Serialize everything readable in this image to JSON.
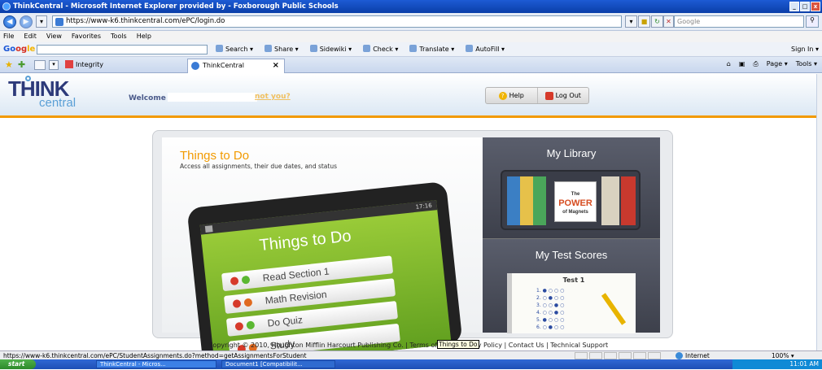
{
  "window": {
    "title": "ThinkCentral - Microsoft Internet Explorer provided by - Foxborough Public Schools",
    "controls": [
      "_",
      "□",
      "x"
    ]
  },
  "address": {
    "url": "https://www-k6.thinkcentral.com/ePC/login.do",
    "search_placeholder": "Google"
  },
  "menu": [
    "File",
    "Edit",
    "View",
    "Favorites",
    "Tools",
    "Help"
  ],
  "googlebar": {
    "logo": [
      "Go",
      "og",
      "le"
    ],
    "tools": [
      "Search ▾",
      "Share ▾",
      "Sidewiki ▾",
      "Check ▾",
      "Translate ▾",
      "AutoFill ▾"
    ],
    "signin": "Sign In ▾"
  },
  "tabs": {
    "bookmark": "Integrity",
    "active": "ThinkCentral",
    "commands": [
      "Page ▾",
      "Tools ▾"
    ]
  },
  "header": {
    "logo_think": "THINK",
    "logo_central": "central",
    "welcome": "Welcome",
    "notyou": "not you?",
    "help": "Help",
    "logout": "Log Out"
  },
  "todo": {
    "title": "Things to Do",
    "subtitle": "Access all assignments, their due dates, and status",
    "screen_title": "Things to Do",
    "time": "17:16",
    "tasks": [
      "Read Section 1",
      "Math Revision",
      "Do Quiz",
      "Study"
    ]
  },
  "library": {
    "title": "My Library",
    "book_title": "POWER",
    "book_top": "The",
    "book_bottom": "of Magnets"
  },
  "scores": {
    "title": "My Test Scores",
    "sheet_title": "Test 1",
    "rows": [
      "1.",
      "2.",
      "3.",
      "4.",
      "5.",
      "6."
    ]
  },
  "footer": {
    "copyright": "Copyright © 2010, Houghton Mifflin Harcourt Publishing Co. | Terms of Use | Privacy Policy | Contact Us | Technical Support",
    "tooltip": "Things to Do"
  },
  "status": {
    "url": "https://www-k6.thinkcentral.com/ePC/StudentAssignments.do?method=getAssignmentsForStudent",
    "zone": "Internet",
    "zoom": "100% ▾"
  },
  "taskbar": {
    "start": "start",
    "task1": "ThinkCentral - Micros...",
    "task2": "Document1 [Compatibilit...",
    "time": "11:01 AM"
  }
}
